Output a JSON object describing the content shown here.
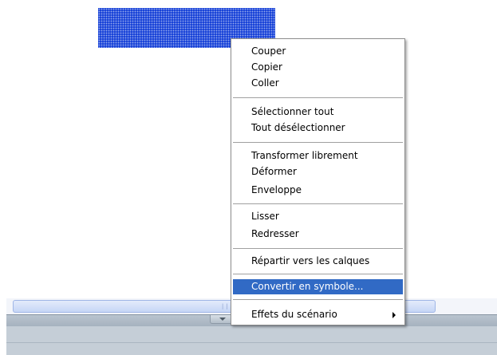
{
  "context_menu": {
    "items": [
      {
        "label": "Couper"
      },
      {
        "label": "Copier"
      },
      {
        "label": "Coller"
      },
      {
        "label": "Sélectionner tout"
      },
      {
        "label": "Tout désélectionner"
      },
      {
        "label": "Transformer librement"
      },
      {
        "label": "Déformer"
      },
      {
        "label": "Enveloppe"
      },
      {
        "label": "Lisser"
      },
      {
        "label": "Redresser"
      },
      {
        "label": "Répartir vers les calques"
      },
      {
        "label": "Convertir en symbole..."
      },
      {
        "label": "Effets du scénario"
      }
    ],
    "highlighted_item": "Convertir en symbole...",
    "highlight_color": "#316ac5"
  },
  "stage": {
    "selected_shape_color": "#1a44d8"
  },
  "icons": {
    "submenu": "chevron-right-icon",
    "scroll_grip": "grip-icon",
    "playhead": "playhead-icon"
  }
}
